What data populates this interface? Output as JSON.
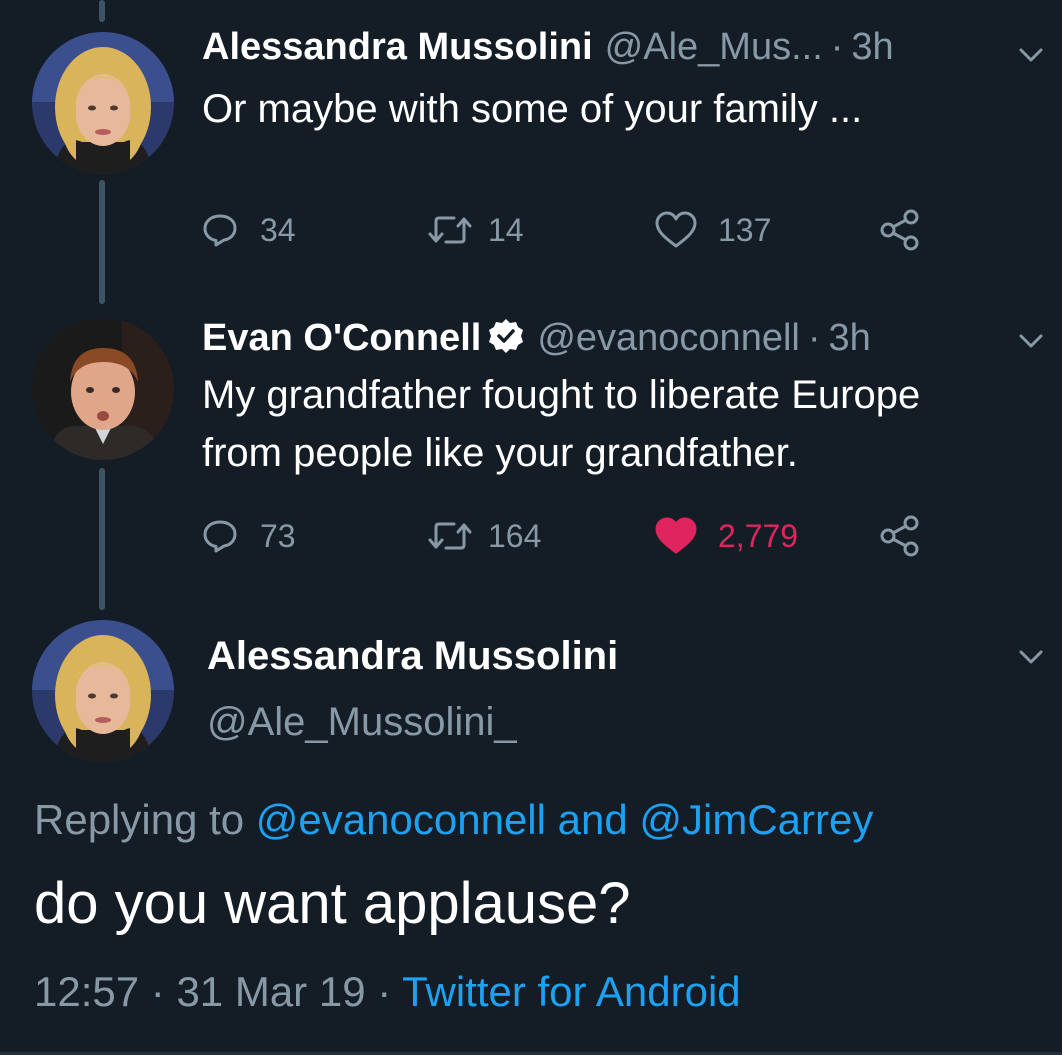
{
  "tweets": [
    {
      "name": "Alessandra Mussolini",
      "handle": "@Ale_Mus...",
      "separator": "·",
      "time": "3h",
      "text": "Or maybe with some of your family ...",
      "replies": "34",
      "retweets": "14",
      "likes": "137",
      "liked": false,
      "avatar": "blonde-woman-avatar"
    },
    {
      "name": "Evan O'Connell",
      "verified": true,
      "handle": "@evanoconnell",
      "separator": "·",
      "time": "3h",
      "text_lines": [
        "My grandfather fought to liberate Europe",
        "from people like your grandfather."
      ],
      "replies": "73",
      "retweets": "164",
      "likes": "2,779",
      "liked": true,
      "avatar": "red-haired-man-avatar"
    }
  ],
  "main_tweet": {
    "name": "Alessandra Mussolini",
    "handle": "@Ale_Mussolini_",
    "replying_prefix": "Replying to",
    "reply_user1": "@evanoconnell",
    "reply_and": "and",
    "reply_user2": "@JimCarrey",
    "text": "do you want applause?",
    "time": "12:57",
    "date": "31 Mar 19",
    "separator": "·",
    "source": "Twitter for Android"
  },
  "colors": {
    "background": "#141d26",
    "muted": "#8899a6",
    "link": "#1da1f2",
    "like": "#e0245e",
    "thread_line": "#3d5466"
  }
}
